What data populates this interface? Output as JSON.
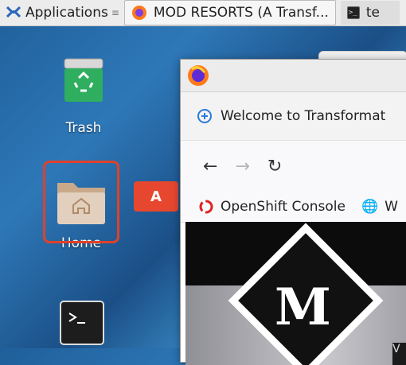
{
  "panel": {
    "applications_label": "Applications",
    "tasks": [
      {
        "title": "MOD RESORTS (A Transf..."
      },
      {
        "title": "te"
      }
    ]
  },
  "desktop": {
    "trash_label": "Trash",
    "home_label": "Home"
  },
  "annotation": {
    "tag": "A",
    "color": "#e0412a"
  },
  "browser": {
    "tab_title": "Welcome to Transformat",
    "bookmark_1": "OpenShift Console",
    "bookmark_2": "W",
    "page_corner_text": "V"
  },
  "colors": {
    "accent_red": "#e8472f",
    "desktop_blue": "#2e78b8"
  }
}
